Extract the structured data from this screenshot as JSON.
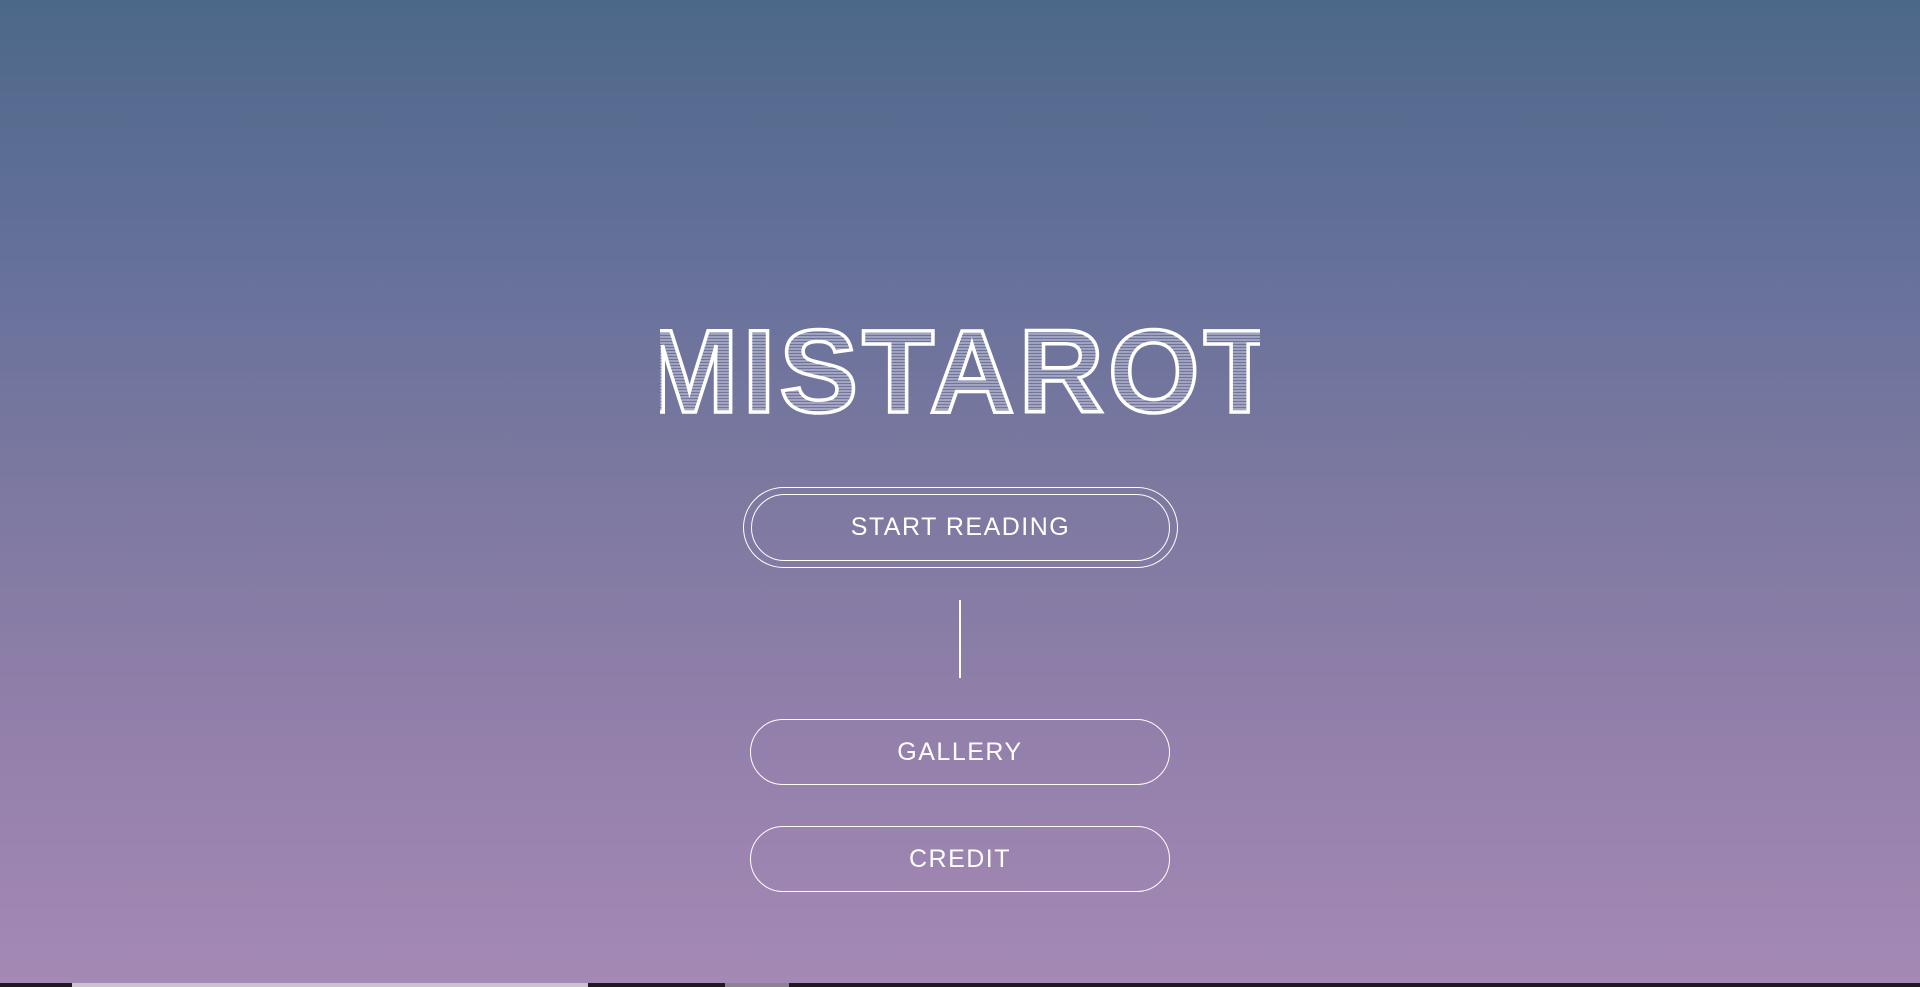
{
  "app": {
    "title": "MISTAROT"
  },
  "menu": {
    "start_label": "START READING",
    "gallery_label": "GALLERY",
    "credit_label": "CREDIT"
  },
  "colors": {
    "gradient_top": "#4c6888",
    "gradient_bottom": "#a589b5",
    "foreground": "#ffffff"
  }
}
